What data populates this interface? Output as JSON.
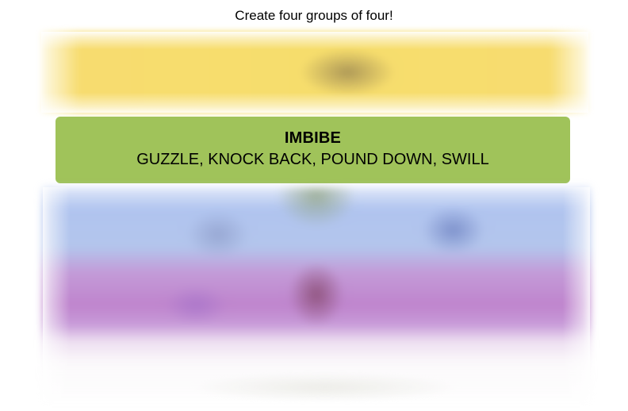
{
  "game": {
    "instructions": "Create four groups of four!",
    "solved_groups": [
      {
        "category": "IMBIBE",
        "members": "GUZZLE, KNOCK BACK, POUND DOWN, SWILL",
        "color": "#a0c35a"
      }
    ],
    "hidden_groups": [
      {
        "state": "blurred",
        "color": "#f7dc6f"
      },
      {
        "state": "blurred",
        "color": "#b0c4ef"
      },
      {
        "state": "blurred",
        "color": "#bf84cd"
      }
    ]
  }
}
